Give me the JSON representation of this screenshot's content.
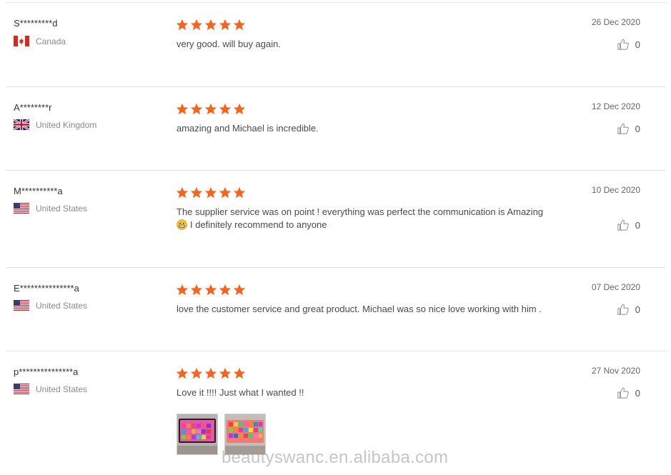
{
  "reviews": [
    {
      "user": "S*********d",
      "country": "Canada",
      "flag": "ca",
      "rating": 5,
      "text": "very good. will buy again.",
      "date": "26 Dec 2020",
      "likes": "0"
    },
    {
      "user": "A********r",
      "country": "United Kingdom",
      "flag": "gb",
      "rating": 5,
      "text": "amazing and Michael is incredible.",
      "date": "12 Dec 2020",
      "likes": "0"
    },
    {
      "user": "M**********a",
      "country": "United States",
      "flag": "us",
      "rating": 5,
      "text": "The supplier service was on point ! everything was perfect the communication is Amazing",
      "text2": "I definitely recommend to anyone",
      "date": "10 Dec 2020",
      "likes": "0"
    },
    {
      "user": "E***************a",
      "country": "United States",
      "flag": "us",
      "rating": 5,
      "text": "love the customer service and great product. Michael was so nice love working with him .",
      "date": "07 Dec 2020",
      "likes": "0"
    },
    {
      "user": "p***************a",
      "country": "United States",
      "flag": "us",
      "rating": 5,
      "text": "Love it !!!! Just what I wanted !!",
      "date": "27 Nov 2020",
      "likes": "0"
    }
  ],
  "watermark": "beautyswanc.en.alibaba.com",
  "colors": {
    "star": "#f26522",
    "divider": "#e3e3e3",
    "muted": "#8a8a8a"
  },
  "icons": {
    "like": "thumbs-up-icon",
    "star": "star-icon",
    "emoji": "grinning-face-emoji"
  }
}
